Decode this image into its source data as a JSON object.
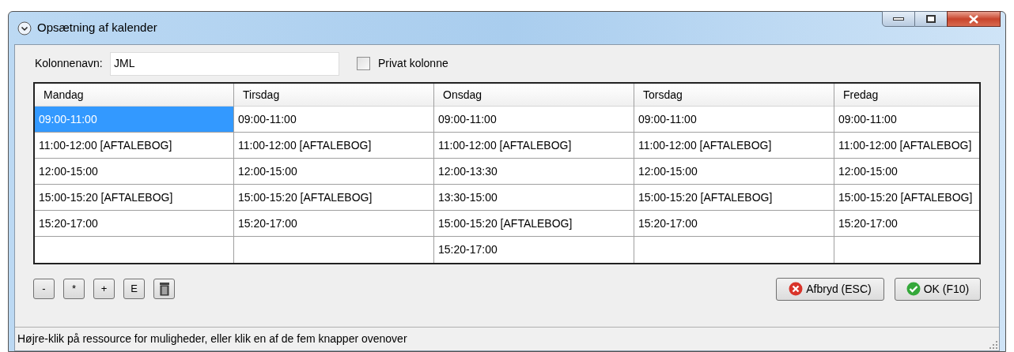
{
  "window": {
    "title": "Opsætning af kalender"
  },
  "column_name": {
    "label": "Kolonnenavn:",
    "value": "JML"
  },
  "private_column": {
    "label": "Privat kolonne",
    "checked": false
  },
  "grid": {
    "columns": [
      {
        "header": "Mandag",
        "cells": [
          {
            "text": "09:00-11:00",
            "selected": true
          },
          {
            "text": "11:00-12:00 [AFTALEBOG]",
            "selected": false
          },
          {
            "text": "12:00-15:00",
            "selected": false
          },
          {
            "text": "15:00-15:20 [AFTALEBOG]",
            "selected": false
          },
          {
            "text": "15:20-17:00",
            "selected": false
          }
        ]
      },
      {
        "header": "Tirsdag",
        "cells": [
          {
            "text": "09:00-11:00",
            "selected": false
          },
          {
            "text": "11:00-12:00 [AFTALEBOG]",
            "selected": false
          },
          {
            "text": "12:00-15:00",
            "selected": false
          },
          {
            "text": "15:00-15:20 [AFTALEBOG]",
            "selected": false
          },
          {
            "text": "15:20-17:00",
            "selected": false
          }
        ]
      },
      {
        "header": "Onsdag",
        "cells": [
          {
            "text": "09:00-11:00",
            "selected": false
          },
          {
            "text": "11:00-12:00 [AFTALEBOG]",
            "selected": false
          },
          {
            "text": "12:00-13:30",
            "selected": false
          },
          {
            "text": "13:30-15:00",
            "selected": false
          },
          {
            "text": "15:00-15:20 [AFTALEBOG]",
            "selected": false
          },
          {
            "text": "15:20-17:00",
            "selected": false
          }
        ]
      },
      {
        "header": "Torsdag",
        "cells": [
          {
            "text": "09:00-11:00",
            "selected": false
          },
          {
            "text": "11:00-12:00 [AFTALEBOG]",
            "selected": false
          },
          {
            "text": "12:00-15:00",
            "selected": false
          },
          {
            "text": "15:00-15:20 [AFTALEBOG]",
            "selected": false
          },
          {
            "text": "15:20-17:00",
            "selected": false
          }
        ]
      },
      {
        "header": "Fredag",
        "cells": [
          {
            "text": "09:00-11:00",
            "selected": false
          },
          {
            "text": "11:00-12:00 [AFTALEBOG]",
            "selected": false
          },
          {
            "text": "12:00-15:00",
            "selected": false
          },
          {
            "text": "15:00-15:20 [AFTALEBOG]",
            "selected": false
          },
          {
            "text": "15:20-17:00",
            "selected": false
          }
        ]
      }
    ]
  },
  "tool_buttons": [
    {
      "kind": "text",
      "label": "-"
    },
    {
      "kind": "text",
      "label": "*"
    },
    {
      "kind": "text",
      "label": "+"
    },
    {
      "kind": "text",
      "label": "E"
    },
    {
      "kind": "trash"
    }
  ],
  "cancel_button": {
    "label": "Afbryd (ESC)"
  },
  "ok_button": {
    "label": "OK (F10)"
  },
  "status_bar": {
    "text": "Højre-klik på ressource for muligheder, eller klik en af de fem knapper ovenover"
  }
}
